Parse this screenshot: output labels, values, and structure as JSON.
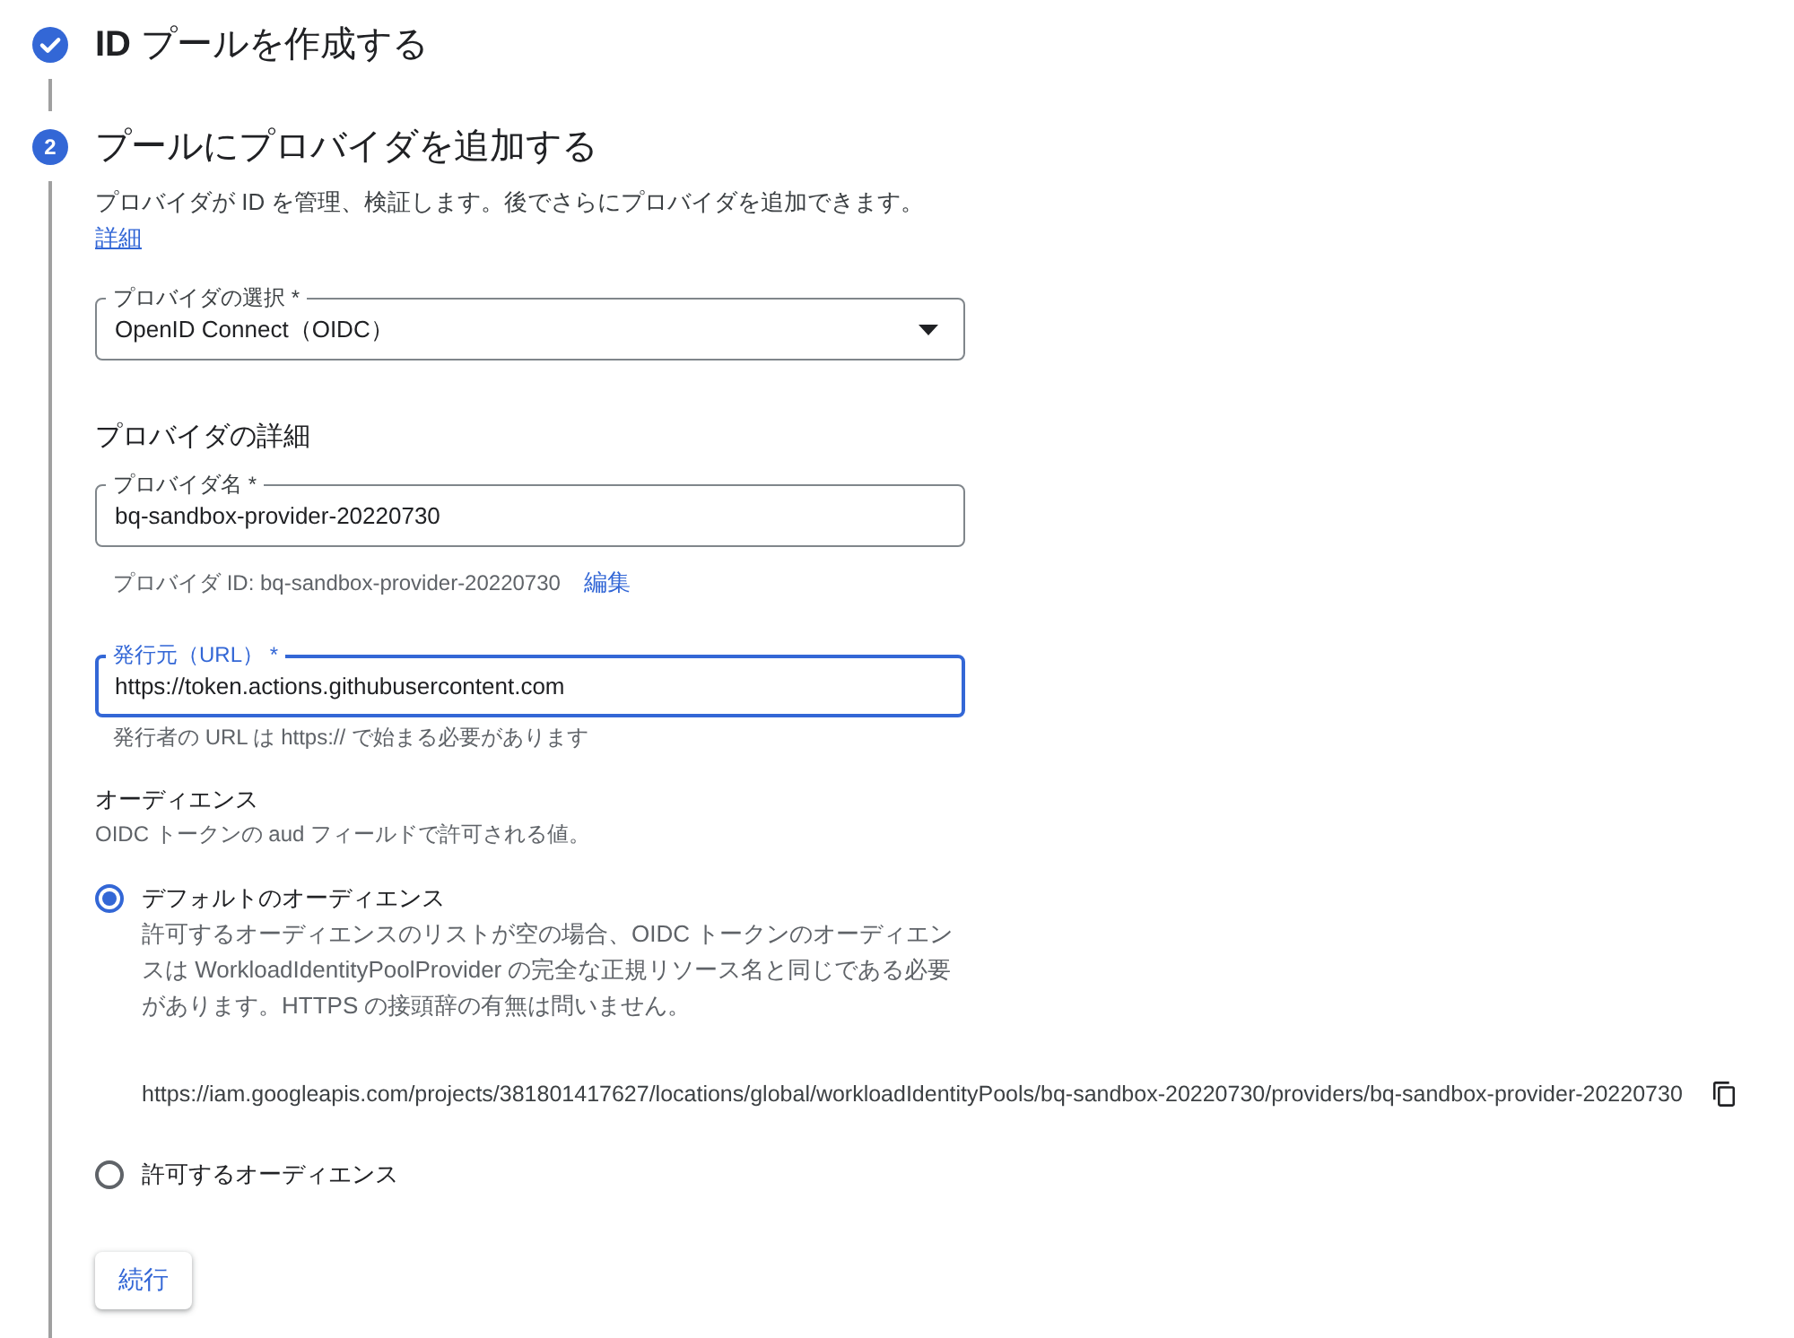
{
  "steps": [
    {
      "title": "**ID** プールを作成する",
      "completed": true
    },
    {
      "number": "2",
      "title": "プールにプロバイダを追加する",
      "completed": false,
      "content": {
        "description": "プロバイダが ID を管理、検証します。後でさらにプロバイダを追加できます。",
        "description_link": "詳細",
        "provider_select": {
          "label": "プロバイダの選択 *",
          "value": "OpenID Connect（OIDC）"
        },
        "details": {
          "heading": "プロバイダの詳細",
          "fields": [
            {
              "label": "プロバイダ名 *",
              "value": "bq-sandbox-provider-20220730",
              "focused": false,
              "hint": "プロバイダ ID: bq-sandbox-provider-20220730",
              "hint_link": "編集"
            },
            {
              "label": "発行元（URL） *",
              "value": "https://token.actions.githubusercontent.com",
              "focused": true,
              "hint": "発行者の URL は https:// で始まる必要があります"
            }
          ]
        },
        "audience": {
          "heading": "オーディエンス",
          "description": "OIDC トークンの aud フィールドで許可される値。",
          "options": [
            {
              "label": "デフォルトのオーディエンス",
              "selected": true,
              "description": "許可するオーディエンスのリストが空の場合、OIDC トークンのオーディエンスは WorkloadIdentityPoolProvider の完全な正規リソース名と同じである必要があります。HTTPS の接頭辞の有無は問いません。",
              "value": "https://iam.googleapis.com/projects/381801417627/locations/global/workloadIdentityPools/bq-sandbox-20220730/providers/bq-sandbox-provider-20220730"
            },
            {
              "label": "許可するオーディエンス",
              "selected": false
            }
          ]
        },
        "continue_button": "続行"
      }
    }
  ]
}
